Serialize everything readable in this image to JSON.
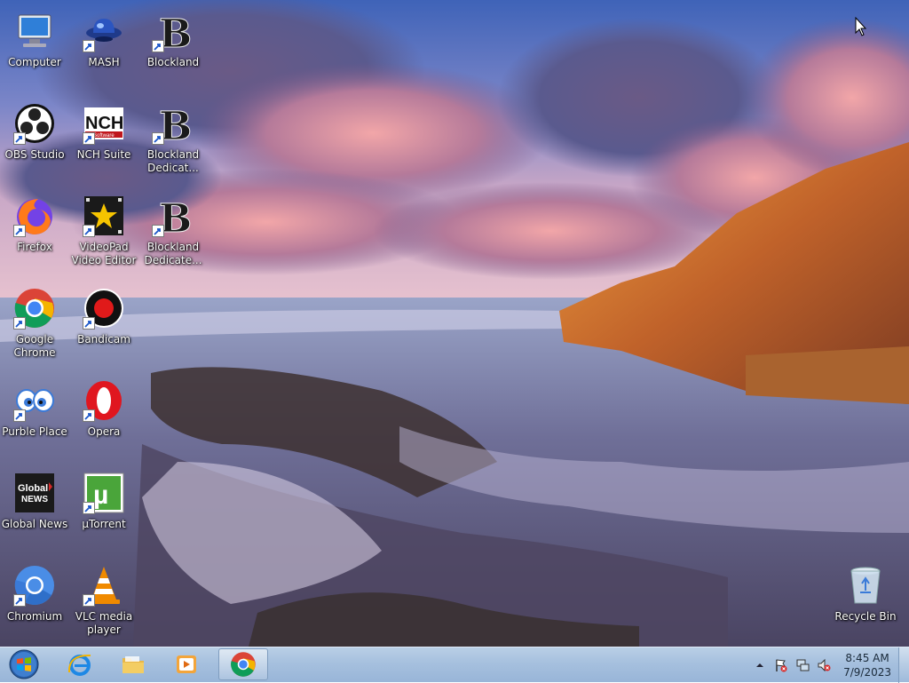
{
  "desktop_icons": [
    {
      "label": "Computer",
      "icon": "computer-icon"
    },
    {
      "label": "MASH",
      "icon": "mash-icon"
    },
    {
      "label": "Blockland",
      "icon": "blockland-icon"
    },
    {
      "label": "OBS Studio",
      "icon": "obs-icon"
    },
    {
      "label": "NCH Suite",
      "icon": "nch-icon"
    },
    {
      "label": "Blockland Dedicat...",
      "icon": "blockland-icon"
    },
    {
      "label": "Firefox",
      "icon": "firefox-icon"
    },
    {
      "label": "VideoPad Video Editor",
      "icon": "videopad-icon"
    },
    {
      "label": "Blockland Dedicate...",
      "icon": "blockland-icon"
    },
    {
      "label": "Google Chrome",
      "icon": "chrome-icon"
    },
    {
      "label": "Bandicam",
      "icon": "bandicam-icon"
    },
    {
      "label": "Purble Place",
      "icon": "purble-place-icon"
    },
    {
      "label": "Opera",
      "icon": "opera-icon"
    },
    {
      "label": "Global News",
      "icon": "global-news-icon"
    },
    {
      "label": "µTorrent",
      "icon": "utorrent-icon"
    },
    {
      "label": "Chromium",
      "icon": "chromium-icon"
    },
    {
      "label": "VLC media player",
      "icon": "vlc-icon"
    },
    {
      "label": "Recycle Bin",
      "icon": "recycle-bin-icon"
    }
  ],
  "icon_badges": {
    "nch": "NCH",
    "nch_sub": "Software",
    "global_news_line1": "Global",
    "global_news_line2": "NEWS",
    "blockland_letter": "B",
    "utorrent_letter": "µ",
    "opera_letter": "O"
  },
  "taskbar": {
    "pinned": [
      {
        "icon": "start-orb-icon"
      },
      {
        "icon": "internet-explorer-icon"
      },
      {
        "icon": "file-explorer-icon"
      },
      {
        "icon": "media-player-icon"
      },
      {
        "icon": "chrome-icon",
        "active": true
      }
    ],
    "tray": {
      "icons": [
        "show-hidden-icons-icon",
        "action-center-icon",
        "network-icon",
        "volume-muted-icon"
      ],
      "time": "8:45 AM",
      "date": "7/9/2023"
    }
  },
  "colors": {
    "taskbar": "#a6c0de",
    "chrome_red": "#db4437",
    "chrome_green": "#0f9d58",
    "chrome_yellow": "#f4b400",
    "chrome_blue": "#4285f4",
    "chromium_blue": "#4a8de6",
    "opera_red": "#e0161f",
    "utorrent_green": "#4aa53a",
    "vlc_orange": "#f08a00",
    "firefox_orange": "#ff7a1a",
    "firefox_purple": "#7342e6"
  }
}
